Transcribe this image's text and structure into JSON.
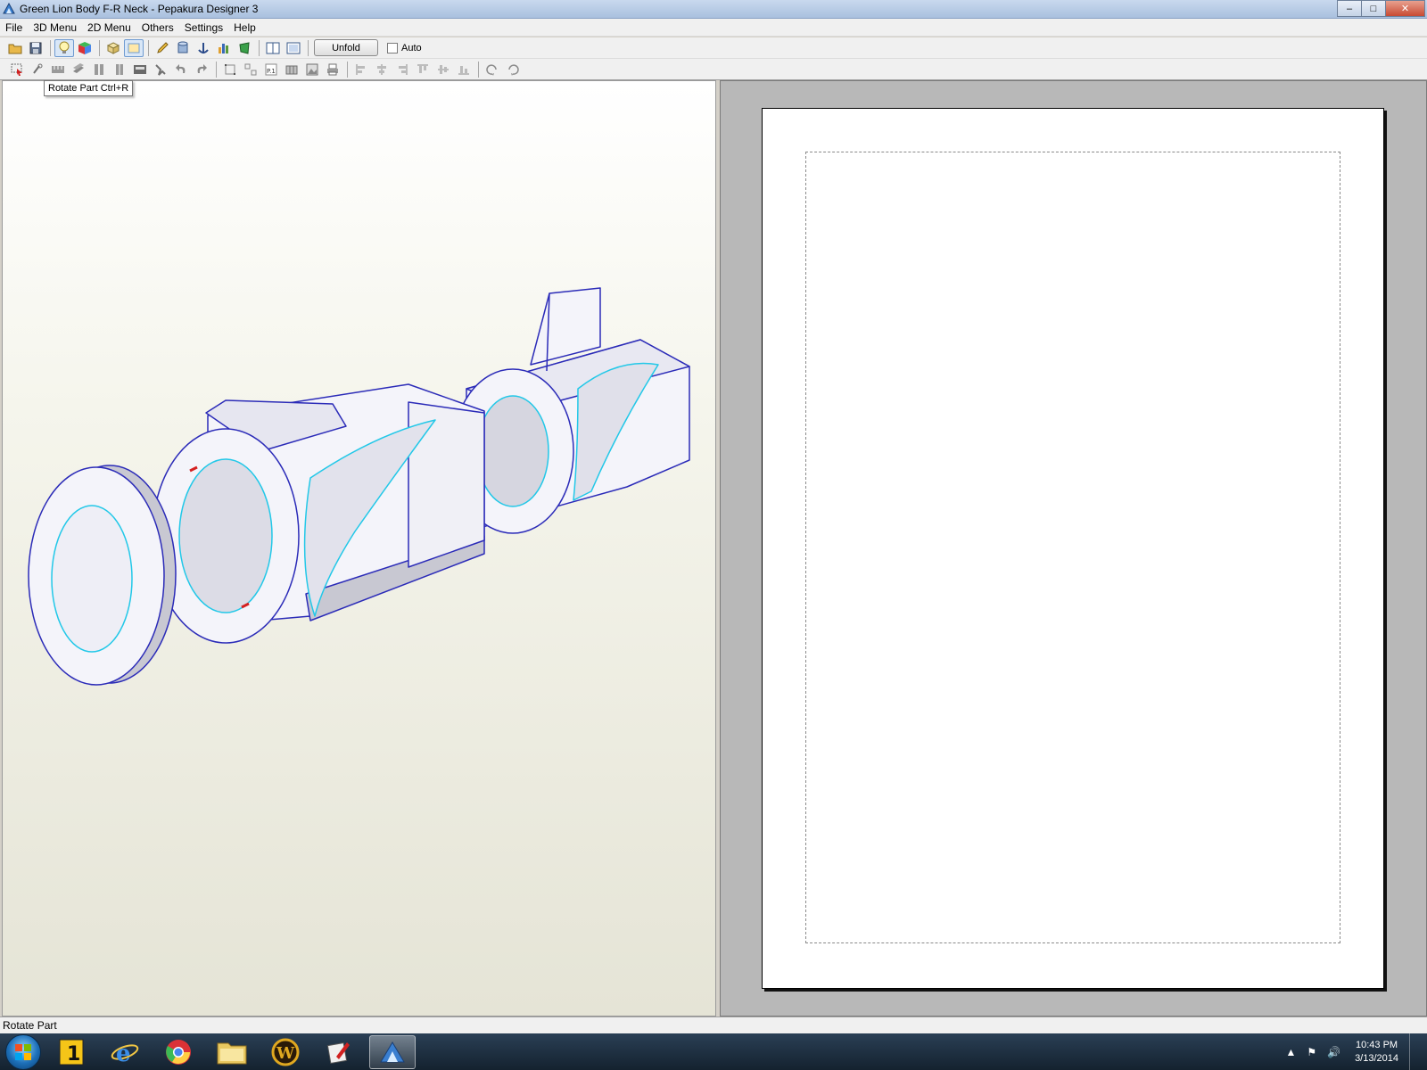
{
  "window": {
    "title": "Green Lion Body F-R Neck - Pepakura Designer 3",
    "minimize_glyph": "–",
    "maximize_glyph": "□",
    "close_glyph": "✕"
  },
  "menu": [
    "File",
    "3D Menu",
    "2D Menu",
    "Others",
    "Settings",
    "Help"
  ],
  "toolbar": {
    "unfold_label": "Unfold",
    "auto_label": "Auto",
    "auto_checked": false
  },
  "tooltip": "Rotate Part Ctrl+R",
  "status": "Rotate Part",
  "taskbar": {
    "clock_time": "10:43 PM",
    "clock_date": "3/13/2014",
    "apps": [
      "start-menu",
      "onenote",
      "internet-explorer",
      "chrome",
      "file-explorer",
      "world-of-warcraft",
      "paint-tool",
      "pepakura"
    ],
    "active_app": "pepakura"
  },
  "colors": {
    "model_edge": "#2b2bb8",
    "model_fold": "#22c8e8",
    "model_face": "#f4f4fa",
    "model_shade": "#c8c8d2",
    "cut_mark": "#d42020"
  }
}
